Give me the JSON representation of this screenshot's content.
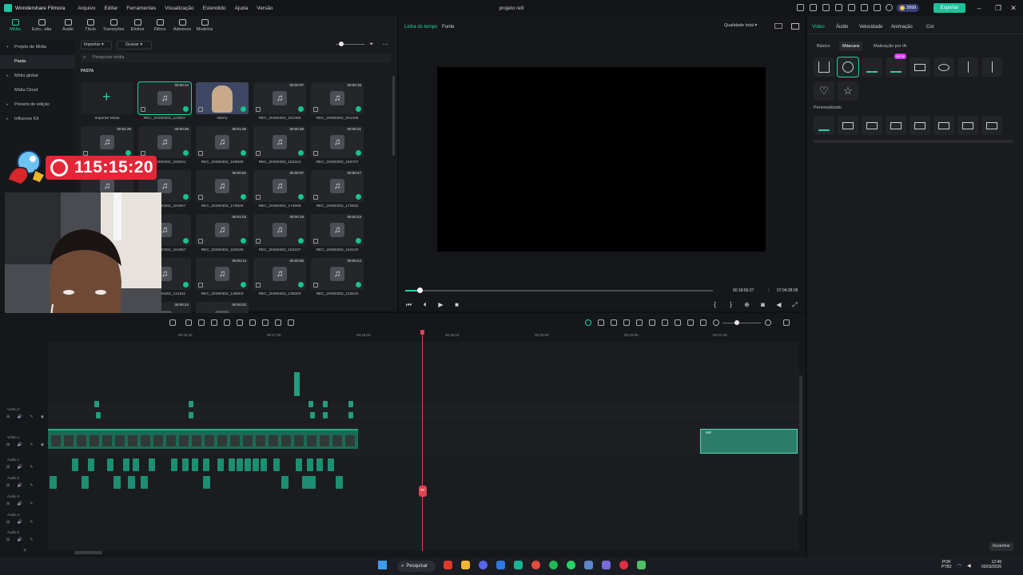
{
  "app": {
    "name": "Wondershare Filmora",
    "menu": [
      "Arquivo",
      "Editar",
      "Ferramentas",
      "Visualização",
      "Estendido",
      "Ajuda",
      "Versão"
    ],
    "project_title": "projeto re9",
    "credits": "3999",
    "export_label": "Exportar"
  },
  "media_tabs": [
    "Mídia",
    "Esto...ídia",
    "Áudio",
    "Título",
    "Transições",
    "Efeitos",
    "Filtros",
    "Adesivos",
    "Modelos"
  ],
  "sidebar": {
    "items": [
      {
        "label": "Projeto de Mídia"
      },
      {
        "label": "Pasta"
      },
      {
        "label": "Mídia global"
      },
      {
        "label": "Mídia Cloud"
      },
      {
        "label": "Presets de edição"
      },
      {
        "label": "Influence Kit"
      }
    ]
  },
  "media_toolbar": {
    "import_label": "Importar",
    "record_label": "Gravar",
    "search_placeholder": "Pesquisar mídia",
    "folder_label": "PASTA"
  },
  "media_items": [
    {
      "caption": "Importar Mídia",
      "duration": "",
      "kind": "import"
    },
    {
      "caption": "REC_20260303_123927",
      "duration": "00:00:12",
      "kind": "audio"
    },
    {
      "caption": "sherry",
      "duration": "",
      "kind": "image"
    },
    {
      "caption": "REC_20260302_201405",
      "duration": "00:00:07",
      "kind": "audio"
    },
    {
      "caption": "REC_20260302_201336",
      "duration": "00:00:15",
      "kind": "audio"
    },
    {
      "caption": "",
      "duration": "00:01:26",
      "kind": "audio"
    },
    {
      "caption": "REC_20260302_192631",
      "duration": "00:00:36",
      "kind": "audio"
    },
    {
      "caption": "REC_20260302_185839",
      "duration": "00:01:26",
      "kind": "audio"
    },
    {
      "caption": "REC_20260302_184224",
      "duration": "00:00:38",
      "kind": "audio"
    },
    {
      "caption": "REC_20260302_183707",
      "duration": "00:00:21",
      "kind": "audio"
    },
    {
      "caption": "",
      "duration": "00:00:41",
      "kind": "audio"
    },
    {
      "caption": "REC_20260302_181807",
      "duration": "",
      "kind": "audio"
    },
    {
      "caption": "REC_20260302_175828",
      "duration": "00:00:52",
      "kind": "audio"
    },
    {
      "caption": "REC_20260302_174508",
      "duration": "00:00:07",
      "kind": "audio"
    },
    {
      "caption": "REC_20260302_172932",
      "duration": "00:00:47",
      "kind": "audio"
    },
    {
      "caption": "",
      "duration": "00:00:17",
      "kind": "audio"
    },
    {
      "caption": "REC_20260302_161957",
      "duration": "",
      "kind": "audio"
    },
    {
      "caption": "REC_20260302_160239",
      "duration": "00:01:03",
      "kind": "audio"
    },
    {
      "caption": "REC_20260302_154237",
      "duration": "00:00:19",
      "kind": "audio"
    },
    {
      "caption": "REC_20260302_152120",
      "duration": "00:00:23",
      "kind": "audio"
    },
    {
      "caption": "",
      "duration": "00:01:16",
      "kind": "audio"
    },
    {
      "caption": "REC_20260302_141511",
      "duration": "",
      "kind": "audio"
    },
    {
      "caption": "REC_20260302_135603",
      "duration": "00:00:14",
      "kind": "audio"
    },
    {
      "caption": "REC_20260302_135203",
      "duration": "00:00:06",
      "kind": "audio"
    },
    {
      "caption": "REC_20260302_133510",
      "duration": "00:00:24",
      "kind": "audio"
    },
    {
      "caption": "",
      "duration": "00:00:10",
      "kind": "audio"
    },
    {
      "caption": "",
      "duration": "00:00:24",
      "kind": "audio"
    },
    {
      "caption": "",
      "duration": "00:00:22",
      "kind": "audio"
    }
  ],
  "overlay": {
    "timer": "115:15:20"
  },
  "preview": {
    "tab_timeline": "Linha do tempo",
    "tab_source": "Fonte",
    "quality": "Qualidade total",
    "current_time": "00:18:56:27",
    "separator": "/",
    "total_time": "07:04:28:09",
    "progress": 0.04
  },
  "right_panel": {
    "tabs": [
      "Vídeo",
      "Áudio",
      "Velocidade",
      "Animação",
      "Cor"
    ],
    "subtabs": [
      "Básico",
      "Máscara",
      "Matização por IA"
    ],
    "beta_badge": "BETA",
    "custom_label": "Personalizado",
    "reset_label": "Redefinir"
  },
  "timeline": {
    "ruler": [
      "00:16:40",
      "00:17:30",
      "00:18:20",
      "00:19:10",
      "00:20:00",
      "00:20:50",
      "00:21:40"
    ],
    "tracks": [
      {
        "label": "Vídeo 2"
      },
      {
        "label": "Vídeo 1"
      },
      {
        "label": "Áudio 1"
      },
      {
        "label": "Áudio 2"
      },
      {
        "label": "Áudio 3"
      },
      {
        "label": "Áudio 4"
      },
      {
        "label": "Áudio 5"
      }
    ],
    "clip_label": "re9"
  },
  "taskbar": {
    "search_label": "Pesquisar",
    "lang_top": "POR",
    "lang_bottom": "PTB2",
    "time": "12:49",
    "date": "03/03/2026"
  },
  "colors": {
    "accent": "#1ed3a5",
    "timer": "#e52638",
    "playhead": "#e0424f",
    "export": "#19c49a"
  }
}
